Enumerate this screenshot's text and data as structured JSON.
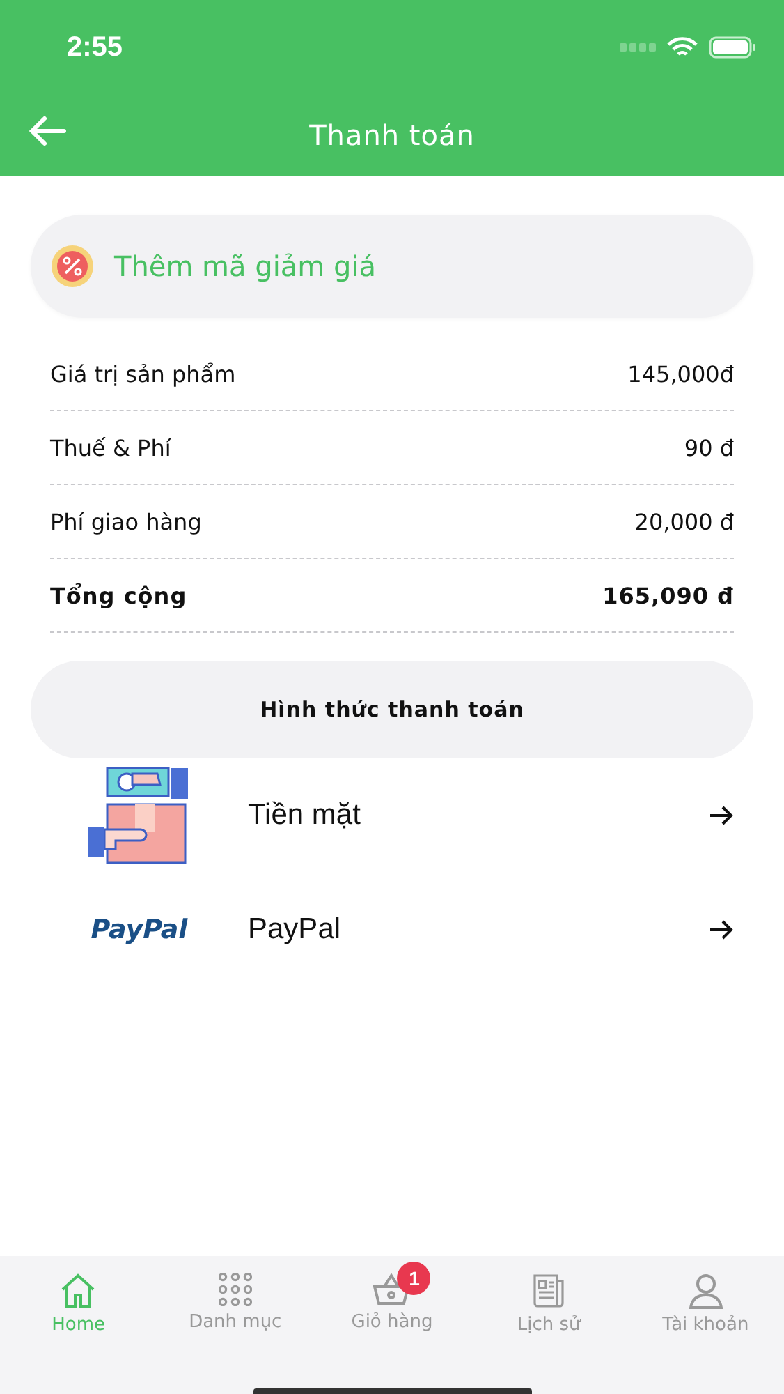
{
  "status_bar": {
    "time": "2:55"
  },
  "header": {
    "title": "Thanh toán"
  },
  "coupon": {
    "label": "Thêm mã giảm giá"
  },
  "summary": [
    {
      "label": "Giá trị sản phẩm",
      "value": "145,000đ",
      "total": false
    },
    {
      "label": "Thuế & Phí",
      "value": "90 đ",
      "total": false
    },
    {
      "label": "Phí giao hàng",
      "value": "20,000 đ",
      "total": false
    },
    {
      "label": "Tổng cộng",
      "value": "165,090 đ",
      "total": true
    }
  ],
  "payment": {
    "title": "Hình thức thanh toán",
    "methods": [
      {
        "kind": "cash",
        "label": "Tiền mặt"
      },
      {
        "kind": "paypal",
        "logo_text": "PayPal",
        "label": "PayPal"
      }
    ]
  },
  "tab_bar": [
    {
      "kind": "home",
      "label": "Home",
      "selected": true
    },
    {
      "kind": "grid",
      "label": "Danh mục",
      "selected": false
    },
    {
      "kind": "basket",
      "label": "Giỏ hàng",
      "selected": false,
      "badge": "1"
    },
    {
      "kind": "news",
      "label": "Lịch sử",
      "selected": false
    },
    {
      "kind": "person",
      "label": "Tài khoản",
      "selected": false
    }
  ]
}
